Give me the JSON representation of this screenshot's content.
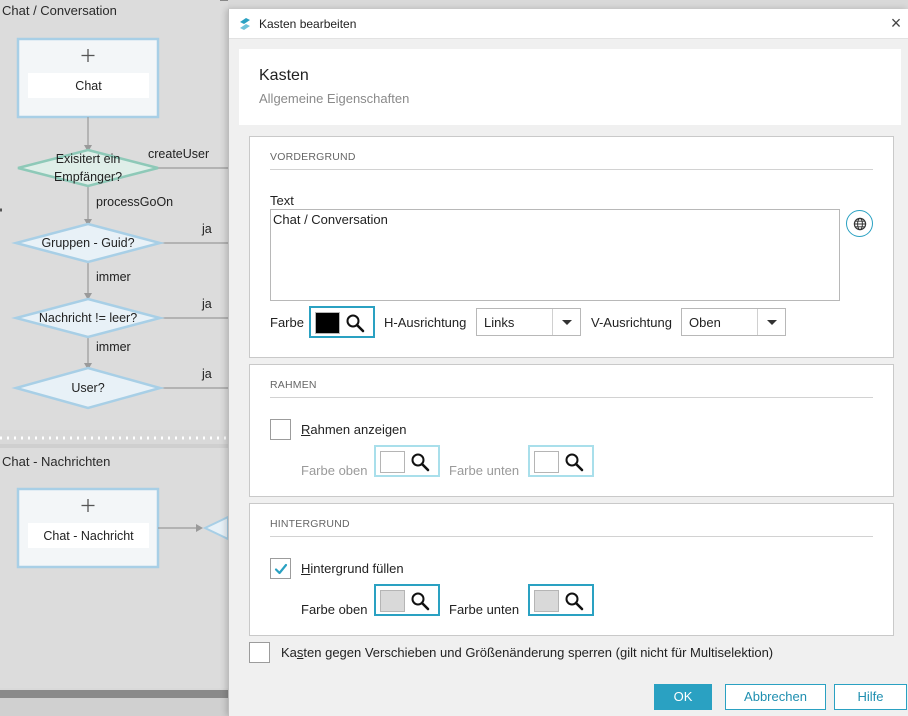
{
  "canvas": {
    "group1_title": "Chat / Conversation",
    "group2_title": "Chat - Nachrichten",
    "nodes": {
      "chat_start": "Chat",
      "empfaenger": "Exisitert ein Empfänger?",
      "gruppen_guid": "Gruppen - Guid?",
      "nachricht_leer": "Nachricht != leer?",
      "user": "User?",
      "chat_nachricht": "Chat - Nachricht"
    },
    "edges": {
      "create_user": "createUser",
      "process_go_on": "processGoOn",
      "ja1": "ja",
      "immer1": "immer",
      "ja2": "ja",
      "immer2": "immer",
      "ja3": "ja"
    },
    "plus_icon": "+"
  },
  "dialog": {
    "window_title": "Kasten bearbeiten",
    "close_glyph": "×",
    "heading": "Kasten",
    "subheading": "Allgemeine Eigenschaften",
    "vordergrund": {
      "title": "VORDERGRUND",
      "text_label": "Text",
      "text_value": "Chat / Conversation",
      "farbe_label": "Farbe",
      "farbe_color": "#000000",
      "h_label": "H-Ausrichtung",
      "h_value": "Links",
      "v_label": "V-Ausrichtung",
      "v_value": "Oben"
    },
    "rahmen": {
      "title": "RAHMEN",
      "checkbox_underlined": "R",
      "checkbox_rest": "ahmen anzeigen",
      "checked": false,
      "farbe_oben_label": "Farbe oben",
      "farbe_unten_label": "Farbe unten",
      "farbe_oben_color": "#ffffff",
      "farbe_unten_color": "#ffffff"
    },
    "hintergrund": {
      "title": "HINTERGRUND",
      "checkbox_underlined": "H",
      "checkbox_rest": "intergrund füllen",
      "checked": true,
      "farbe_oben_label": "Farbe oben",
      "farbe_unten_label": "Farbe unten",
      "farbe_oben_color": "#d9d9d9",
      "farbe_unten_color": "#d9d9d9"
    },
    "lock": {
      "prefix": "Ka",
      "underlined": "s",
      "rest": "ten gegen Verschieben und Größenänderung sperren (gilt nicht für Multiselektion)",
      "checked": false
    },
    "buttons": {
      "ok": "OK",
      "cancel": "Abbrechen",
      "help": "Hilfe"
    }
  },
  "colors": {
    "accent": "#2aa1c2",
    "node_border": "#a8cfe6",
    "diamond_fill": "#dfeee8",
    "diamond_border": "#8ec9b8"
  }
}
